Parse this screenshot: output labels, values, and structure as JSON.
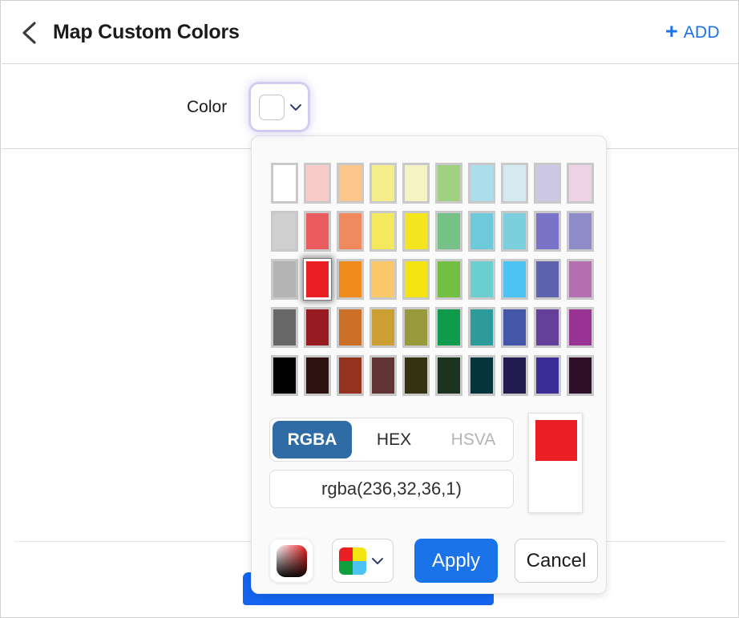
{
  "header": {
    "back_icon": "chevron-left-icon",
    "title": "Map Custom Colors",
    "add_plus": "+",
    "add_label": "ADD"
  },
  "color_row": {
    "label": "Color",
    "trigger_swatch_color": "#ffffff",
    "chevron_icon": "chevron-down-icon",
    "checkbox_checked": false,
    "delete_icon": "delete-circle-icon",
    "delete_color": "#d9363e"
  },
  "body": {
    "primary_cta_label": ""
  },
  "picker": {
    "palette_rows": [
      [
        "#ffffff",
        "#f8cbcb",
        "#fac68c",
        "#f4ee8a",
        "#f7f2c4",
        "#a0d182",
        "#aadeea",
        "#d5eaf0",
        "#cdc8e6",
        "#eed2e5"
      ],
      [
        "#cfcfcf",
        "#ea5c60",
        "#f08a5e",
        "#f4e85f",
        "#f3e51e",
        "#76c286",
        "#6ecada",
        "#7ccfdd",
        "#7a74c8",
        "#8e8bc8"
      ],
      [
        "#b4b4b4",
        "#ec2024",
        "#f08c1b",
        "#fbc86a",
        "#f3e511",
        "#72bf44",
        "#6ccfcf",
        "#4cc3f2",
        "#5f63ae",
        "#b470b0"
      ],
      [
        "#676767",
        "#981b22",
        "#cc6f27",
        "#cc9f33",
        "#97993a",
        "#109a4c",
        "#2e9b9b",
        "#4356a8",
        "#65409b",
        "#9a3494"
      ],
      [
        "#020202",
        "#2e1211",
        "#93331f",
        "#613435",
        "#33340f",
        "#1c3320",
        "#03353a",
        "#221c51",
        "#3a2d96",
        "#301029"
      ]
    ],
    "selected_row": 2,
    "selected_col": 1,
    "format_tabs": [
      {
        "label": "RGBA",
        "state": "active"
      },
      {
        "label": "HEX",
        "state": "normal"
      },
      {
        "label": "HSVA",
        "state": "disabled"
      }
    ],
    "value": "rgba(236,32,36,1)",
    "preview_new_color": "#ec2024",
    "preview_old_color": "#ffffff",
    "gradient_icon": "gradient-picker-icon",
    "palette_select_icon": "palette-quadrant-icon",
    "palette_select_chevron": "chevron-down-icon",
    "quadrant_colors": [
      "#ec2024",
      "#f3e511",
      "#0fa03c",
      "#4cc3f2"
    ],
    "apply_label": "Apply",
    "cancel_label": "Cancel"
  }
}
